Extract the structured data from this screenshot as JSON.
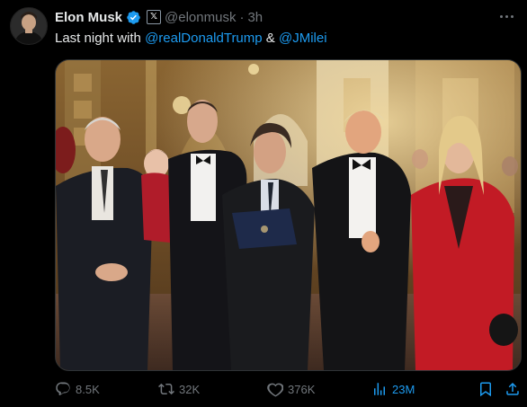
{
  "tweet": {
    "author_name": "Elon Musk",
    "author_handle": "@elonmusk",
    "separator": "·",
    "time": "3h",
    "text_prefix": "Last night with ",
    "mention1": "@realDonaldTrump",
    "text_and": " & ",
    "mention2": "@JMilei"
  },
  "actions": {
    "replies": "8.5K",
    "reposts": "32K",
    "likes": "376K",
    "views": "23M"
  },
  "icons": {
    "verified": "verified-badge-icon",
    "x_badge": "x-affiliate-badge",
    "more": "more-icon",
    "reply": "reply-icon",
    "repost": "repost-icon",
    "like": "like-icon",
    "views": "views-icon",
    "bookmark": "bookmark-icon",
    "share": "share-icon"
  },
  "colors": {
    "background": "#000000",
    "text": "#e7e9ea",
    "secondary": "#71767b",
    "accent": "#1d9bf0"
  }
}
